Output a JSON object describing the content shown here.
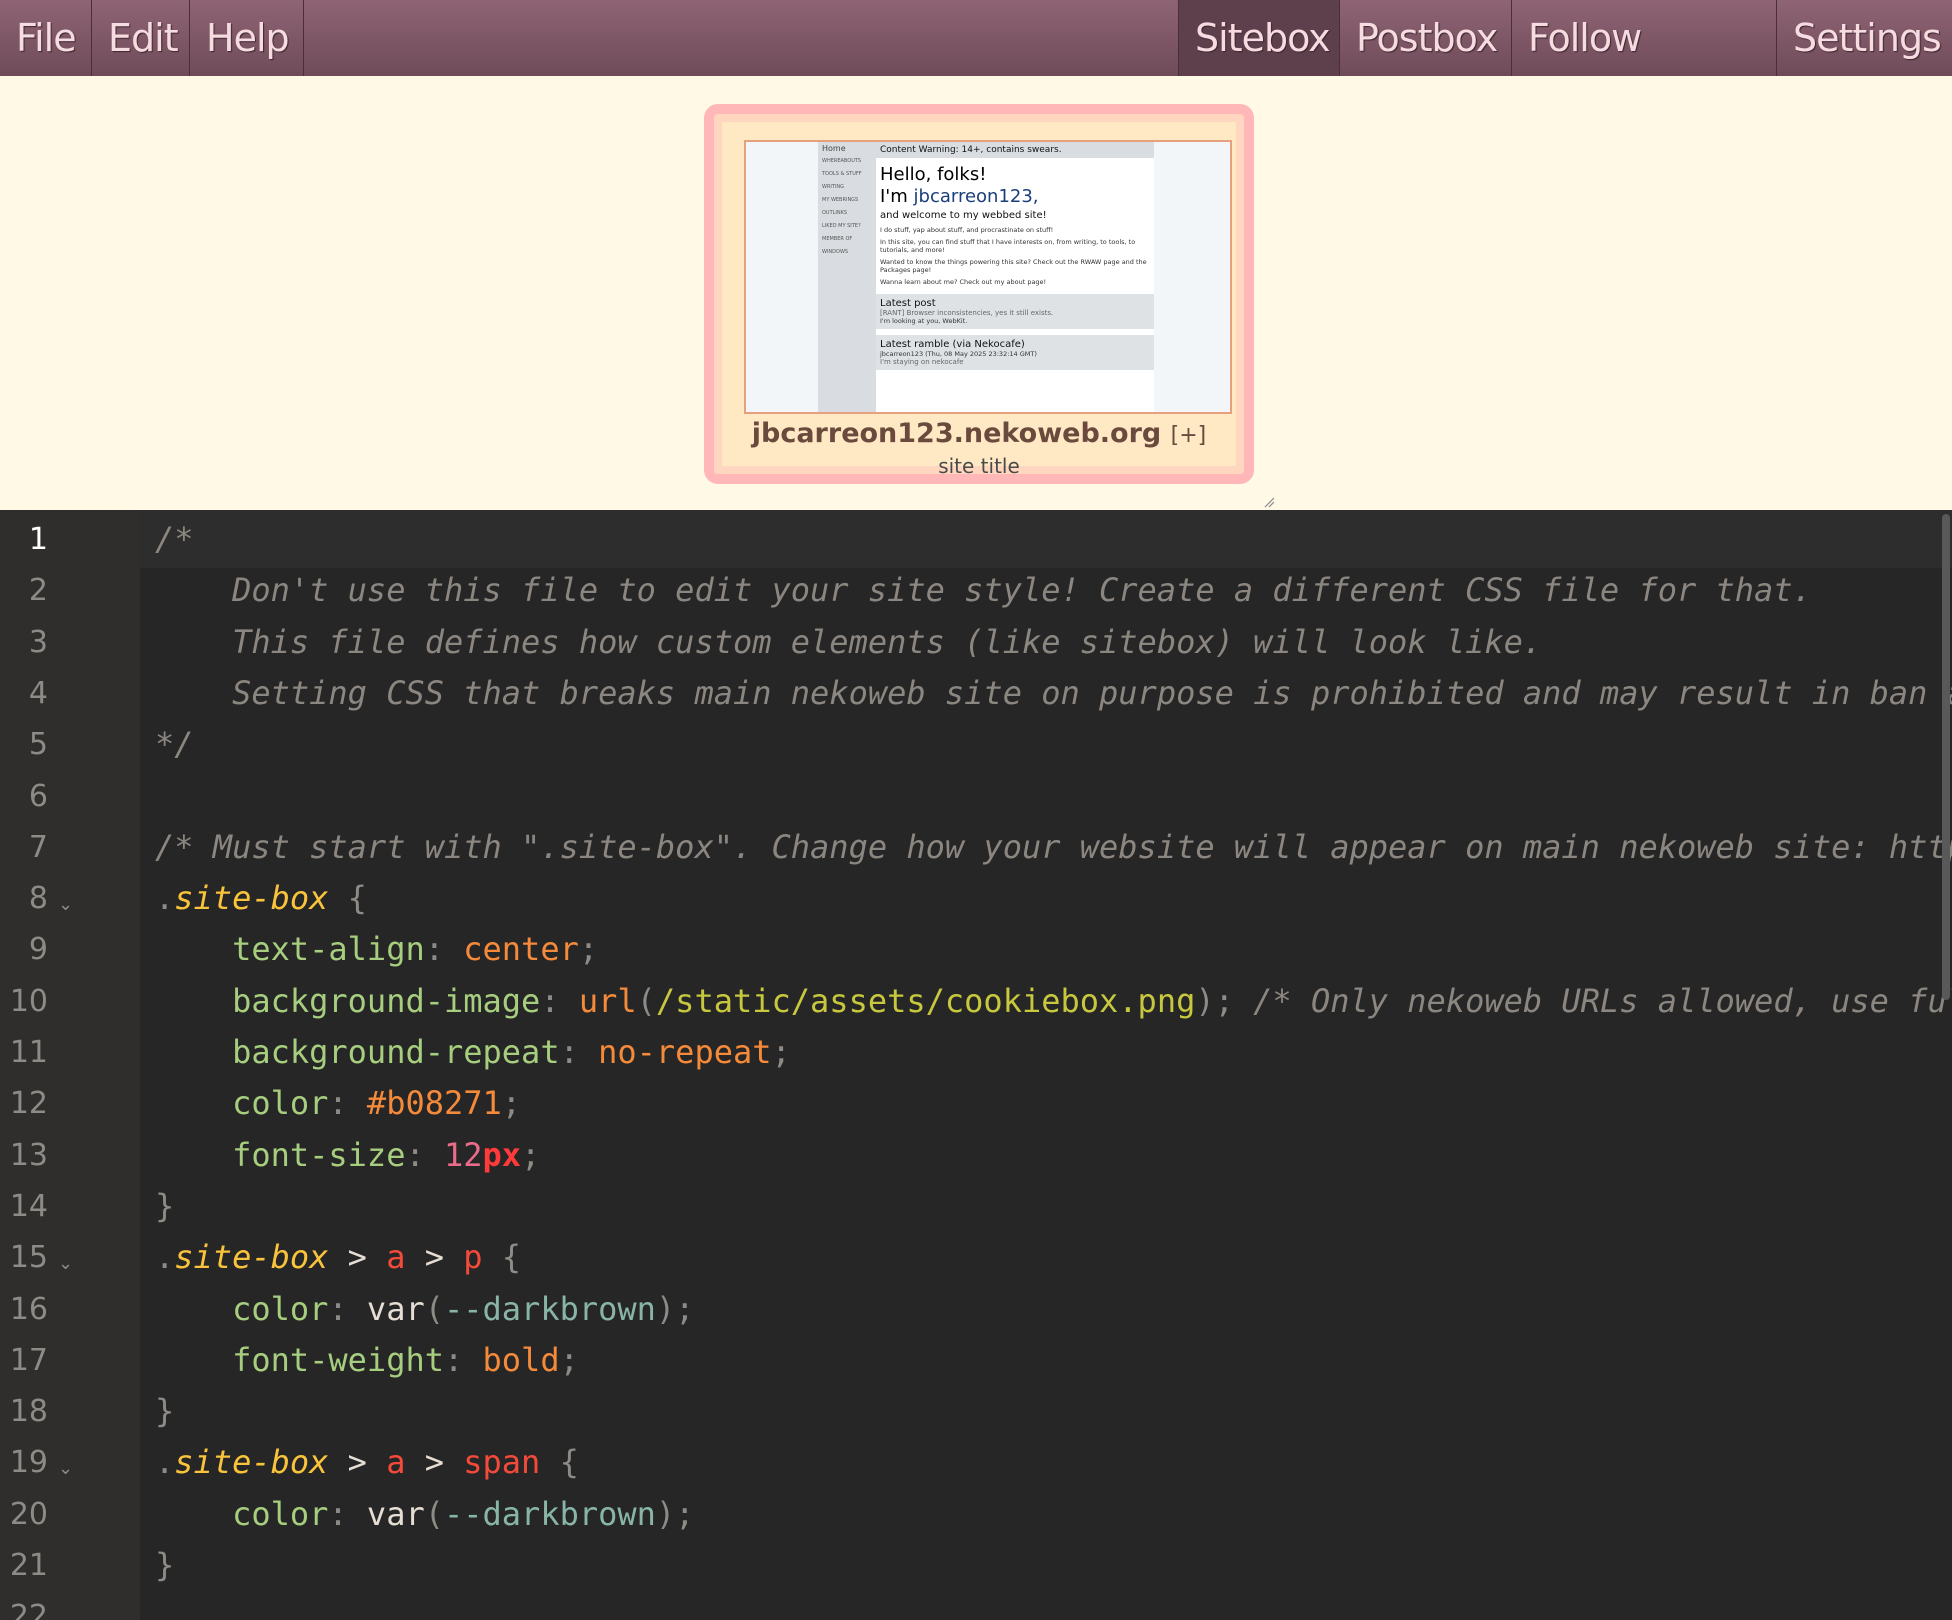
{
  "menubar": {
    "left": [
      "File",
      "Edit",
      "Help"
    ],
    "right": [
      "Sitebox",
      "Postbox",
      "Follow Button",
      "Settings"
    ],
    "active": "Sitebox"
  },
  "sitebox": {
    "url": "jbcarreon123.nekoweb.org",
    "plus": "[+]",
    "title": "site title",
    "thumb": {
      "home": "Home",
      "nav": [
        "WHEREABOUTS",
        "TOOLS & STUFF",
        "WRITING",
        "MY WEBRINGS",
        "OUTLINKS",
        "LIKED MY SITE?",
        "MEMBER OF",
        "WINDOWS"
      ],
      "warning": "Content Warning: 14+, contains swears.",
      "hello": "Hello, folks!",
      "im": "I'm ",
      "name": "jbcarreon123,",
      "welcome": "and welcome to my webbed site!",
      "p1": "I do stuff, yap about stuff, and procrastinate on stuff!",
      "p2": "In this site, you can find stuff that I have interests on, from writing, to tools, to tutorials, and more!",
      "p3": "Wanted to know the things powering this site? Check out the RWAW page and the Packages page!",
      "p4": "Wanna learn about me? Check out my about page!",
      "latest_post_title": "Latest post",
      "latest_post_link": "[RANT] Browser inconsistencies, yes it still exists.",
      "latest_post_text": "I'm looking at you, WebKit.",
      "ramble_title": "Latest ramble (via Nekocafe)",
      "ramble_meta": "jbcarreon123 (Thu, 08 May 2025 23:32:14 GMT)",
      "ramble_text": "I'm staying on nekocafe"
    }
  },
  "editor": {
    "lines": [
      {
        "n": "1",
        "segs": [
          [
            "cm",
            "/*"
          ]
        ]
      },
      {
        "n": "2",
        "segs": [
          [
            "cm",
            "    Don't use this file to edit your site style! Create a different CSS file for that."
          ]
        ]
      },
      {
        "n": "3",
        "segs": [
          [
            "cm",
            "    This file defines how custom elements (like sitebox) will look like."
          ]
        ]
      },
      {
        "n": "4",
        "segs": [
          [
            "cm",
            "    Setting CSS that breaks main nekoweb site on purpose is prohibited and may result in ban a"
          ]
        ]
      },
      {
        "n": "5",
        "segs": [
          [
            "cm",
            "*/"
          ]
        ]
      },
      {
        "n": "6",
        "segs": []
      },
      {
        "n": "7",
        "segs": [
          [
            "cm",
            "/* Must start with \".site-box\". Change how your website will appear on main nekoweb site: http"
          ]
        ]
      },
      {
        "n": "8",
        "fold": true,
        "segs": [
          [
            "pn",
            "."
          ],
          [
            "sel",
            "site-box"
          ],
          [
            "pn",
            " {"
          ]
        ]
      },
      {
        "n": "9",
        "segs": [
          [
            "",
            "    "
          ],
          [
            "prop",
            "text-align"
          ],
          [
            "pn",
            ": "
          ],
          [
            "val",
            "center"
          ],
          [
            "pn",
            ";"
          ]
        ]
      },
      {
        "n": "10",
        "segs": [
          [
            "",
            "    "
          ],
          [
            "prop",
            "background-image"
          ],
          [
            "pn",
            ": "
          ],
          [
            "val",
            "url"
          ],
          [
            "pn",
            "("
          ],
          [
            "str",
            "/static/assets/cookiebox.png"
          ],
          [
            "pn",
            "); "
          ],
          [
            "cm",
            "/* Only nekoweb URLs allowed, use ful"
          ]
        ]
      },
      {
        "n": "11",
        "segs": [
          [
            "",
            "    "
          ],
          [
            "prop",
            "background-repeat"
          ],
          [
            "pn",
            ": "
          ],
          [
            "val",
            "no-repeat"
          ],
          [
            "pn",
            ";"
          ]
        ]
      },
      {
        "n": "12",
        "segs": [
          [
            "",
            "    "
          ],
          [
            "prop",
            "color"
          ],
          [
            "pn",
            ": "
          ],
          [
            "val",
            "#b08271"
          ],
          [
            "pn",
            ";"
          ]
        ]
      },
      {
        "n": "13",
        "segs": [
          [
            "",
            "    "
          ],
          [
            "prop",
            "font-size"
          ],
          [
            "pn",
            ": "
          ],
          [
            "num",
            "12"
          ],
          [
            "unit",
            "px"
          ],
          [
            "pn",
            ";"
          ]
        ]
      },
      {
        "n": "14",
        "segs": [
          [
            "pn",
            "}"
          ]
        ]
      },
      {
        "n": "15",
        "fold": true,
        "segs": [
          [
            "pn",
            "."
          ],
          [
            "sel",
            "site-box"
          ],
          [
            "fn",
            " > "
          ],
          [
            "tag",
            "a"
          ],
          [
            "fn",
            " > "
          ],
          [
            "tag",
            "p"
          ],
          [
            "pn",
            " {"
          ]
        ]
      },
      {
        "n": "16",
        "segs": [
          [
            "",
            "    "
          ],
          [
            "prop",
            "color"
          ],
          [
            "pn",
            ": "
          ],
          [
            "fn",
            "var"
          ],
          [
            "pn",
            "("
          ],
          [
            "var",
            "--darkbrown"
          ],
          [
            "pn",
            ");"
          ]
        ]
      },
      {
        "n": "17",
        "segs": [
          [
            "",
            "    "
          ],
          [
            "prop",
            "font-weight"
          ],
          [
            "pn",
            ": "
          ],
          [
            "val",
            "bold"
          ],
          [
            "pn",
            ";"
          ]
        ]
      },
      {
        "n": "18",
        "segs": [
          [
            "pn",
            "}"
          ]
        ]
      },
      {
        "n": "19",
        "fold": true,
        "segs": [
          [
            "pn",
            "."
          ],
          [
            "sel",
            "site-box"
          ],
          [
            "fn",
            " > "
          ],
          [
            "tag",
            "a"
          ],
          [
            "fn",
            " > "
          ],
          [
            "tag",
            "span"
          ],
          [
            "pn",
            " {"
          ]
        ]
      },
      {
        "n": "20",
        "segs": [
          [
            "",
            "    "
          ],
          [
            "prop",
            "color"
          ],
          [
            "pn",
            ": "
          ],
          [
            "fn",
            "var"
          ],
          [
            "pn",
            "("
          ],
          [
            "var",
            "--darkbrown"
          ],
          [
            "pn",
            ");"
          ]
        ]
      },
      {
        "n": "21",
        "segs": [
          [
            "pn",
            "}"
          ]
        ]
      },
      {
        "n": "22",
        "segs": []
      }
    ]
  }
}
